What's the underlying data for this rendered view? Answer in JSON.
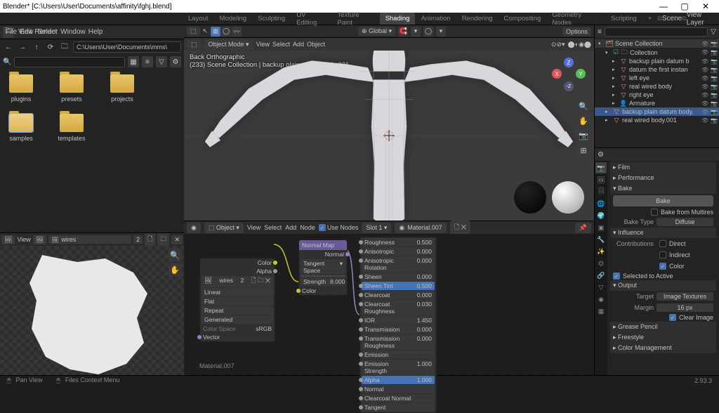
{
  "window": {
    "title": "Blender* [C:\\Users\\User\\Documents\\affinity\\fghj.blend]"
  },
  "topmenu": [
    "File",
    "Edit",
    "Render",
    "Window",
    "Help"
  ],
  "sceneDropdown": "Scene",
  "viewLayerDropdown": "View Layer",
  "workspaces": [
    "Layout",
    "Modeling",
    "Sculpting",
    "UV Editing",
    "Texture Paint",
    "Shading",
    "Animation",
    "Rendering",
    "Compositing",
    "Geometry Nodes",
    "Scripting"
  ],
  "activeWorkspace": "Shading",
  "fileBrowser": {
    "headerMenu": [
      "View",
      "Select"
    ],
    "path": "C:\\Users\\User\\Documents\\mms\\",
    "folders": [
      {
        "name": "plugins",
        "selected": false
      },
      {
        "name": "presets",
        "selected": false
      },
      {
        "name": "projects",
        "selected": false
      },
      {
        "name": "samples",
        "selected": true
      },
      {
        "name": "templates",
        "selected": false
      }
    ]
  },
  "uv": {
    "menu": [
      "View"
    ],
    "imageName": "wires",
    "count": "2"
  },
  "viewport": {
    "topMenu": [
      "View",
      "Select",
      "Add",
      "Object"
    ],
    "modeLabel": "Object Mode",
    "orientation": "Global",
    "options": "Options",
    "info1": "Back Orthographic",
    "info2": "(233) Scene Collection | backup plain datum body.001"
  },
  "nodeEditor": {
    "menu": [
      "View",
      "Select",
      "Add",
      "Node"
    ],
    "objectLabel": "Object",
    "useNodes": "Use Nodes",
    "slot": "Slot 1",
    "material": "Material.007",
    "texNode": {
      "name": "wires",
      "count": "2",
      "rows": [
        {
          "label": "Linear"
        },
        {
          "label": "Flat"
        },
        {
          "label": "Repeat"
        },
        {
          "label": "Generated"
        },
        {
          "label": "Color Space",
          "value": "sRGB"
        }
      ],
      "outVector": "Vector",
      "outColor": "Color",
      "outAlpha": "Alpha"
    },
    "normalMapNode": {
      "title": "Normal Map",
      "outNormal": "Normal",
      "space": "Tangent Space",
      "strength": "Strength",
      "strengthVal": "8.000",
      "inColor": "Color"
    },
    "shaderRows": [
      {
        "label": "Roughness",
        "value": "0.500"
      },
      {
        "label": "Anisotropic",
        "value": "0.000"
      },
      {
        "label": "Anisotropic Rotation",
        "value": "0.000"
      },
      {
        "label": "Sheen",
        "value": "0.000"
      },
      {
        "label": "Sheen Tint",
        "value": "0.500",
        "selected": true
      },
      {
        "label": "Clearcoat",
        "value": "0.000"
      },
      {
        "label": "Clearcoat Roughness",
        "value": "0.030"
      },
      {
        "label": "IOR",
        "value": "1.450"
      },
      {
        "label": "Transmission",
        "value": "0.000"
      },
      {
        "label": "Transmission Roughness",
        "value": "0.000"
      },
      {
        "label": "Emission",
        "value": ""
      },
      {
        "label": "Emission Strength",
        "value": "1.000"
      },
      {
        "label": "Alpha",
        "value": "1.000",
        "selected": true
      },
      {
        "label": "Normal",
        "value": ""
      },
      {
        "label": "Clearcoat Normal",
        "value": ""
      },
      {
        "label": "Tangent",
        "value": ""
      }
    ],
    "bottomLabel": "Material.007"
  },
  "outliner": {
    "rows": [
      {
        "depth": 0,
        "label": "Scene Collection",
        "icon": "scene",
        "expand": "▾"
      },
      {
        "depth": 1,
        "label": "Collection",
        "icon": "collection",
        "expand": "▾",
        "checked": true
      },
      {
        "depth": 2,
        "label": "backup plain datum b",
        "icon": "mesh",
        "expand": "▸"
      },
      {
        "depth": 2,
        "label": "datum the first instan",
        "icon": "mesh",
        "expand": "▸"
      },
      {
        "depth": 2,
        "label": "left eye",
        "icon": "mesh",
        "expand": "▸"
      },
      {
        "depth": 2,
        "label": "real wired body",
        "icon": "mesh",
        "expand": "▸"
      },
      {
        "depth": 2,
        "label": "right eye",
        "icon": "mesh",
        "expand": "▸"
      },
      {
        "depth": 2,
        "label": "Armature",
        "icon": "armature",
        "expand": "▸"
      },
      {
        "depth": 1,
        "label": "backup plain datum body.",
        "icon": "mesh",
        "expand": "▸",
        "active": true
      },
      {
        "depth": 1,
        "label": "real wired body.001",
        "icon": "mesh",
        "expand": "▸"
      }
    ]
  },
  "props": {
    "sections": {
      "film": "Film",
      "performance": "Performance",
      "bake": "Bake",
      "bakeBtn": "Bake",
      "bakeMultires": "Bake from Multires",
      "bakeType": "Bake Type",
      "bakeTypeVal": "Diffuse",
      "influence": "Influence",
      "contributions": "Contributions",
      "direct": "Direct",
      "indirect": "Indirect",
      "color": "Color",
      "selectedToActive": "Selected to Active",
      "output": "Output",
      "target": "Target",
      "targetVal": "Image Textures",
      "margin": "Margin",
      "marginVal": "16 px",
      "clearImage": "Clear Image",
      "greasePencil": "Grease Pencil",
      "freestyle": "Freestyle",
      "colorManagement": "Color Management"
    }
  },
  "statusbar": {
    "left1": "Pan View",
    "left2": "Files Context Menu",
    "version": "2.93.3"
  }
}
